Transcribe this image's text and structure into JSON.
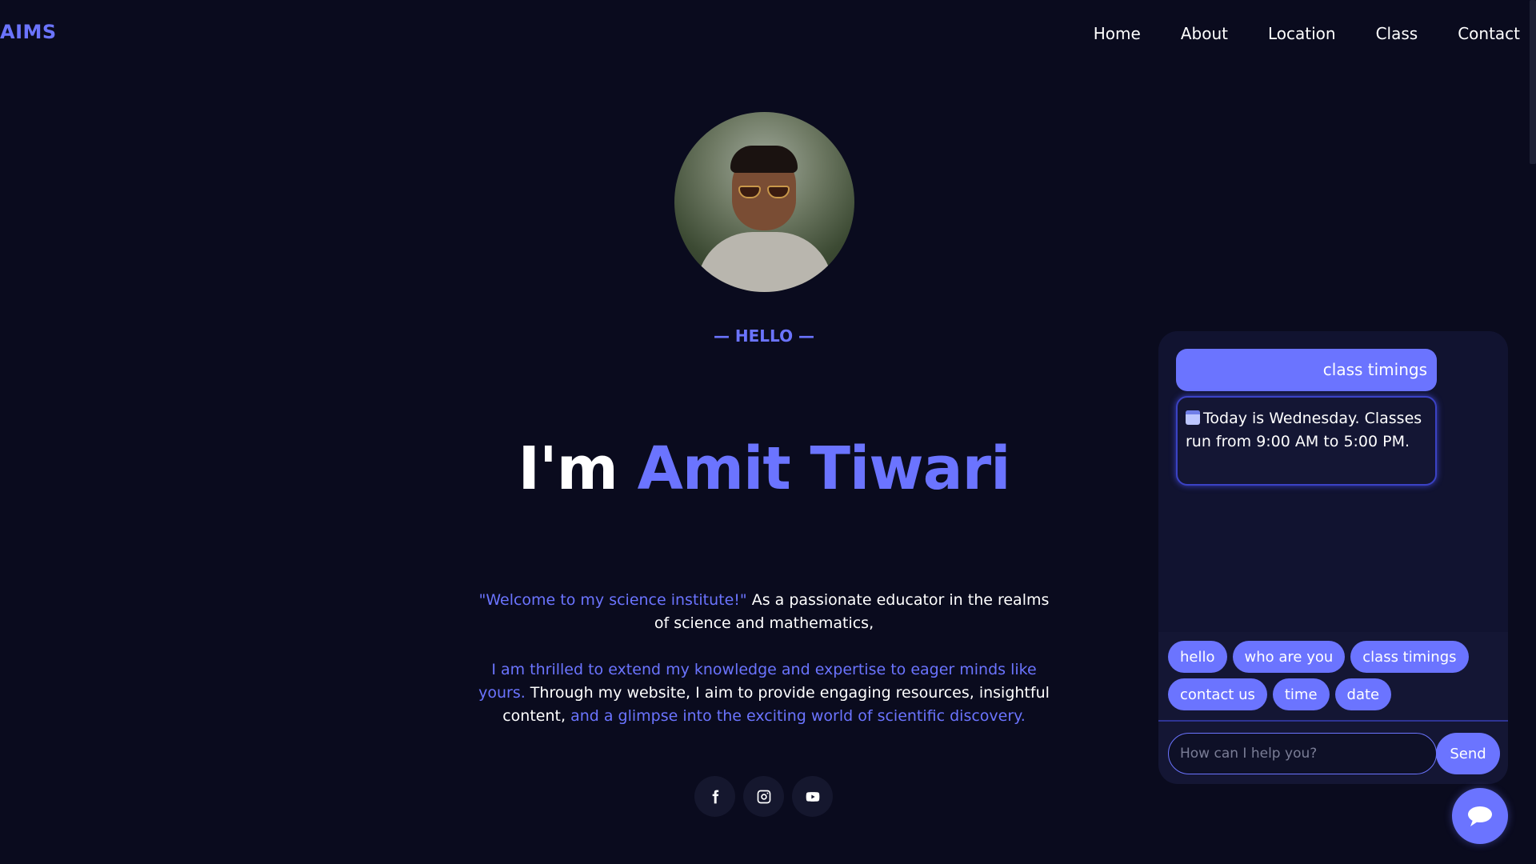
{
  "brand": {
    "logo": "AIMS",
    "accent": "#6b74ff",
    "background": "#0a0b1e"
  },
  "nav": {
    "items": [
      "Home",
      "About",
      "Location",
      "Class",
      "Contact"
    ]
  },
  "hero": {
    "greeting": "— HELLO —",
    "title_prefix": "I'm ",
    "title_name": "Amit Tiwari",
    "intro": {
      "p1_highlight": "\"Welcome to my science institute!\"",
      "p1_text": " As a passionate educator in the realms of science and mathematics,",
      "p2_highlight": "I am thrilled to extend my knowledge and expertise to eager minds like yours.",
      "p2_text": " Through my website, I aim to provide engaging resources, insightful content, ",
      "p2_highlight2": "and a glimpse into the exciting world of scientific discovery."
    },
    "socials": [
      "facebook-icon",
      "instagram-icon",
      "youtube-icon"
    ]
  },
  "chat": {
    "user_message": "class timings",
    "bot_message": "Today is Wednesday. Classes run from 9:00 AM to 5:00 PM.",
    "quick_replies": [
      "hello",
      "who are you",
      "class timings",
      "contact us",
      "time",
      "date"
    ],
    "input_placeholder": "How can I help you?",
    "send_label": "Send"
  }
}
